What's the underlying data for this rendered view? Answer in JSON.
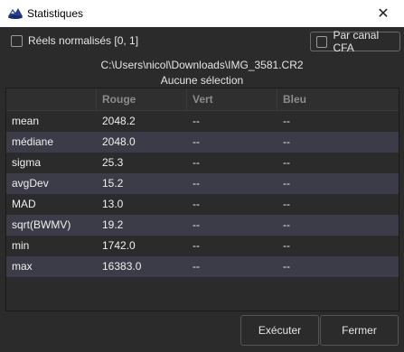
{
  "window": {
    "title": "Statistiques"
  },
  "options": {
    "normalized_label": "Réels normalisés [0, 1]",
    "cfa_label": "Par canal CFA"
  },
  "file_path": "C:\\Users\\nicol\\Downloads\\IMG_3581.CR2",
  "selection_status": "Aucune sélection",
  "table": {
    "headers": [
      "",
      "Rouge",
      "Vert",
      "Bleu"
    ],
    "rows": [
      [
        "mean",
        "2048.2",
        "--",
        "--"
      ],
      [
        "médiane",
        "2048.0",
        "--",
        "--"
      ],
      [
        "sigma",
        "25.3",
        "--",
        "--"
      ],
      [
        "avgDev",
        "15.2",
        "--",
        "--"
      ],
      [
        "MAD",
        "13.0",
        "--",
        "--"
      ],
      [
        "sqrt(BWMV)",
        "19.2",
        "--",
        "--"
      ],
      [
        "min",
        "1742.0",
        "--",
        "--"
      ],
      [
        "max",
        "16383.0",
        "--",
        "--"
      ]
    ]
  },
  "buttons": {
    "run": "Exécuter",
    "close": "Fermer"
  },
  "icons": {
    "app": "app-icon",
    "close": "close-icon"
  },
  "colors": {
    "background": "#2b2b2b",
    "alt_row": "#3c3c48",
    "header_text": "#8c8c8c"
  }
}
